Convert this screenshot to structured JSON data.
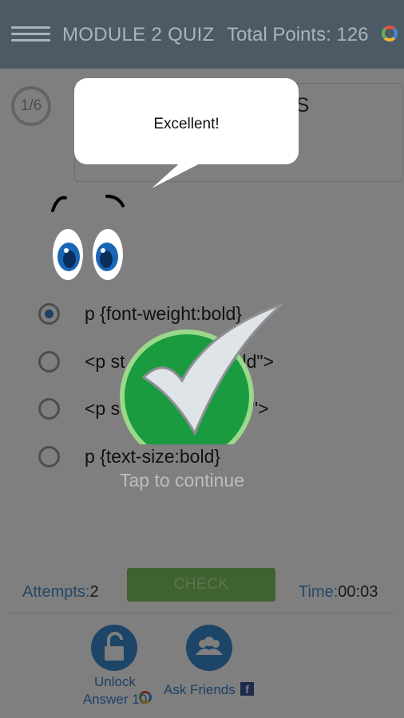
{
  "header": {
    "title": "MODULE 2 QUIZ",
    "points_label": "Total Points: 126"
  },
  "question": {
    "progress": "1/6",
    "text_partial": "SS\np"
  },
  "options": [
    {
      "label": "p {font-weight:bold}",
      "selected": true
    },
    {
      "label": "<p st                  :bold\">",
      "selected": false
    },
    {
      "label": "<p s                   bold\">",
      "selected": false
    },
    {
      "label": "p {text-size:bold}",
      "selected": false
    }
  ],
  "footer": {
    "attempts_label": "Attempts:",
    "attempts_value": "2",
    "check_label": "CHECK",
    "time_label": "Time:",
    "time_value": "00:03",
    "unlock_label": "Unlock Answer 10",
    "ask_friends_label": "Ask Friends"
  },
  "feedback": {
    "bubble_text": "Excellent!",
    "tap_text": "Tap to continue"
  },
  "colors": {
    "header_bg": "#4c5a66",
    "accent_blue": "#3b8ad0",
    "check_green": "#1a9b3f"
  }
}
